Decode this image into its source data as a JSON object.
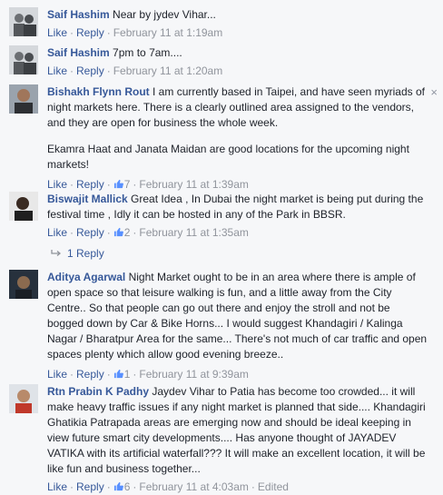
{
  "comments": [
    {
      "author": "Saif Hashim",
      "text": [
        "Near by jydev Vihar..."
      ],
      "like": "Like",
      "reply": "Reply",
      "likes": "",
      "time": "February 11 at 1:19am",
      "edited": ""
    },
    {
      "author": "Saif Hashim",
      "text": [
        "7pm to 7am...."
      ],
      "like": "Like",
      "reply": "Reply",
      "likes": "",
      "time": "February 11 at 1:20am",
      "edited": ""
    },
    {
      "author": "Bishakh Flynn Rout",
      "text": [
        "I am currently based in Taipei, and have seen myriads of night markets here. There is a clearly outlined area assigned to the vendors, and they are open for business the whole week.",
        "Ekamra Haat and Janata Maidan are good locations for the upcoming night markets!"
      ],
      "like": "Like",
      "reply": "Reply",
      "likes": "7",
      "time": "February 11 at 1:39am",
      "edited": ""
    },
    {
      "author": "Biswajit Mallick",
      "text": [
        "Great Idea , In Dubai the night market is being put during the festival time , Idly it can be hosted in any of the Park in BBSR."
      ],
      "like": "Like",
      "reply": "Reply",
      "likes": "2",
      "time": "February 11 at 1:35am",
      "edited": ""
    },
    {
      "author": "Aditya Agarwal",
      "text": [
        "Night Market ought to be in an area where there is ample of open space so that leisure walking is fun, and a little away from the City Centre.. So that people can go out there and enjoy the stroll and not be bogged down by Car & Bike Horns... I would suggest Khandagiri / Kalinga Nagar / Bharatpur Area for the same... There's not much of car traffic and open spaces plenty which allow good evening breeze.."
      ],
      "like": "Like",
      "reply": "Reply",
      "likes": "1",
      "time": "February 11 at 9:39am",
      "edited": ""
    },
    {
      "author": "Rtn Prabin K Padhy",
      "text": [
        "Jaydev Vihar to Patia has become too crowded... it will make heavy traffic issues if any night market is planned that side.... Khandagiri Ghatikia Patrapada areas are emerging now and should be ideal keeping in view future smart city developments.... Has anyone thought of JAYADEV VATIKA with its artificial waterfall??? It will make an excellent location, it will be like fun and business together..."
      ],
      "like": "Like",
      "reply": "Reply",
      "likes": "6",
      "time": "February 11 at 4:03am",
      "edited": "Edited"
    }
  ],
  "replies_link": "1 Reply",
  "close_icon": "×",
  "colors": {
    "link": "#365899",
    "meta": "#90949c",
    "background": "#f6f7f9"
  }
}
